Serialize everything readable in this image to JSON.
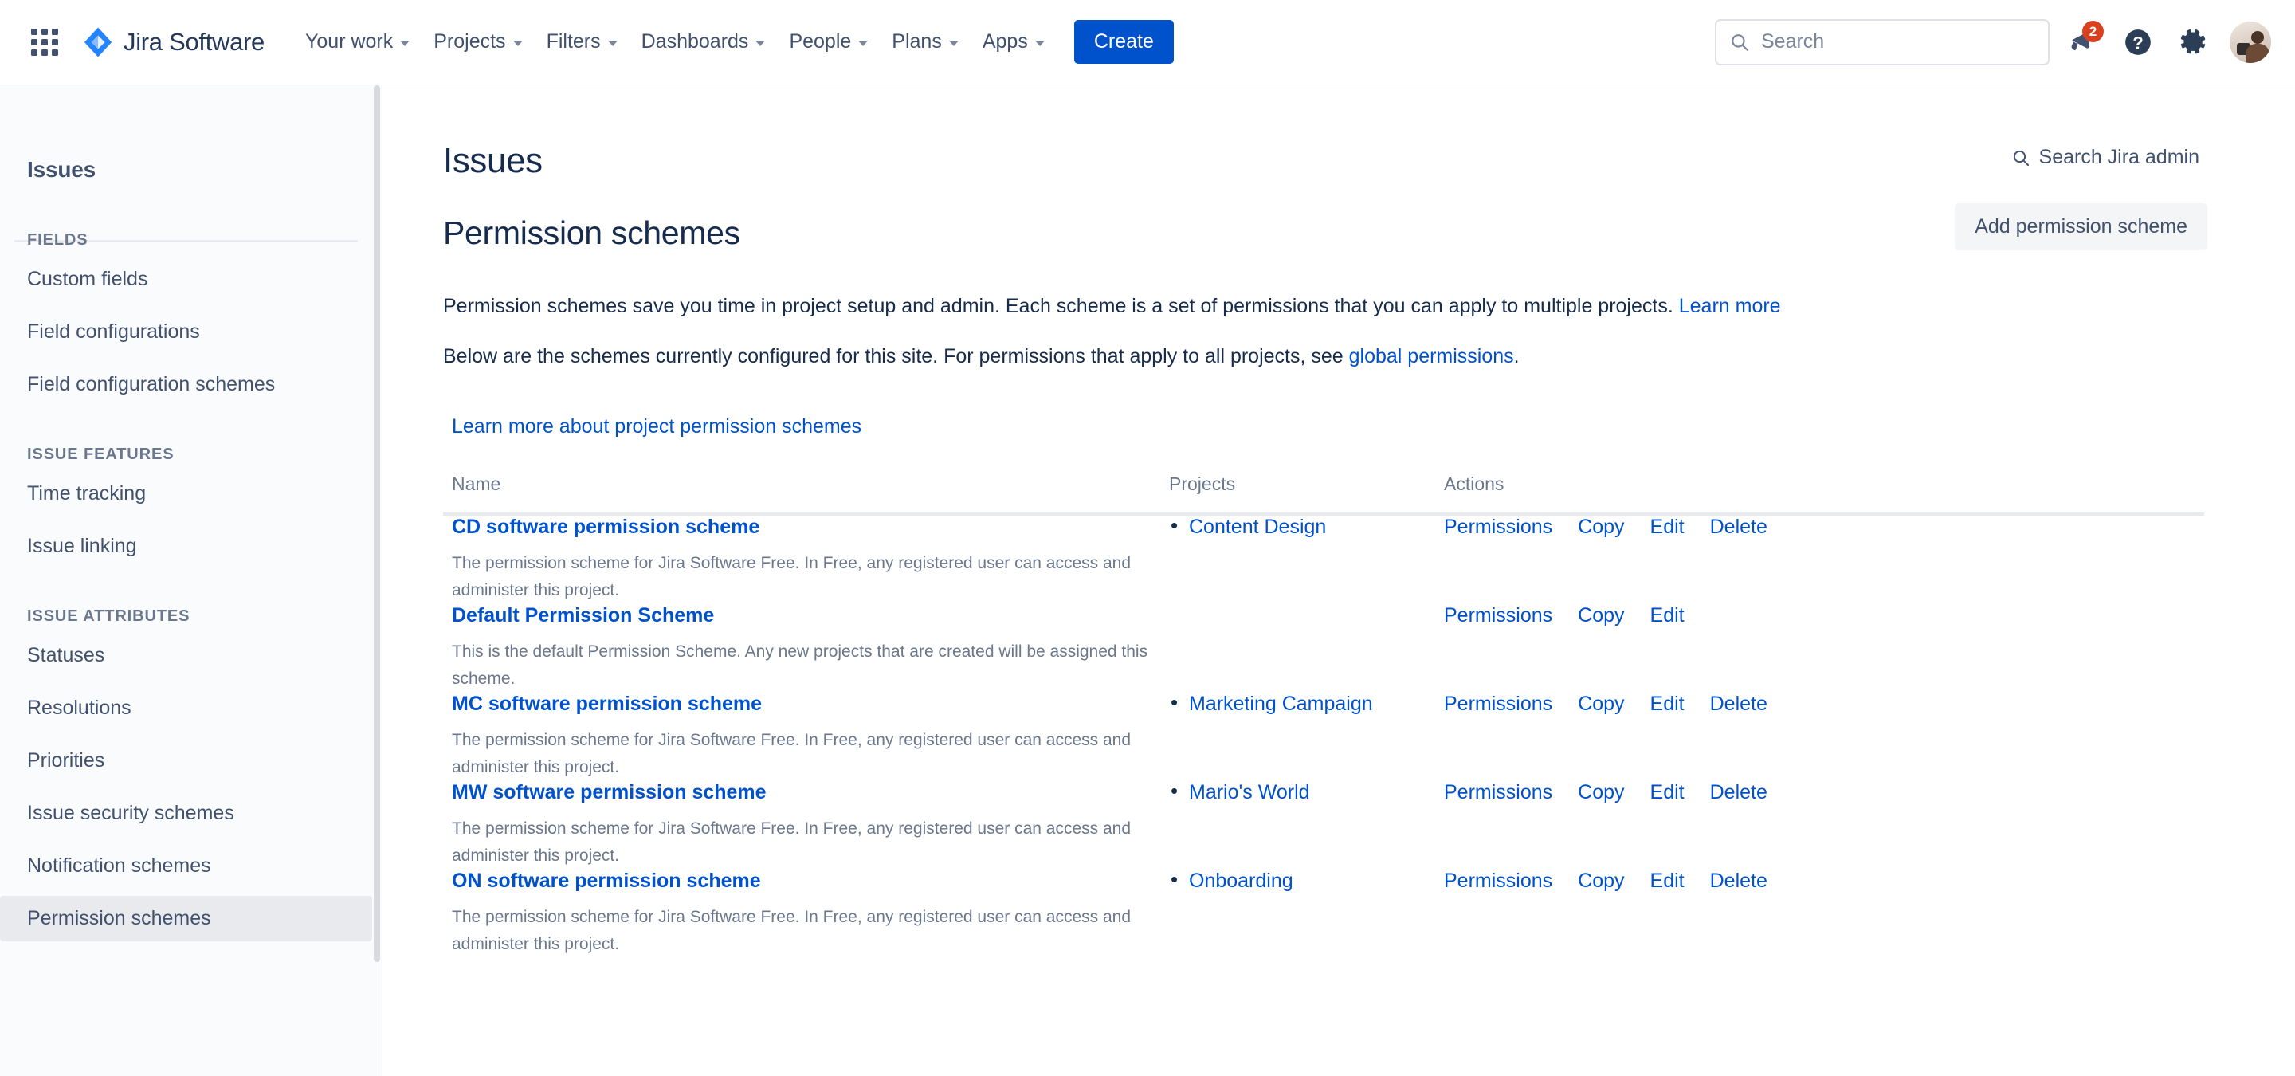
{
  "topnav": {
    "app_switcher_label": "App switcher",
    "brand": "Jira Software",
    "items": [
      {
        "label": "Your work"
      },
      {
        "label": "Projects"
      },
      {
        "label": "Filters"
      },
      {
        "label": "Dashboards"
      },
      {
        "label": "People"
      },
      {
        "label": "Plans"
      },
      {
        "label": "Apps"
      }
    ],
    "create_label": "Create",
    "search": {
      "value": "",
      "placeholder": "Search"
    },
    "notifications_badge": "2",
    "help_label": "Help",
    "settings_label": "Settings",
    "avatar_label": "Your profile and settings"
  },
  "sidebar": {
    "title": "Issues",
    "groups": [
      {
        "heading": "FIELDS",
        "items": [
          {
            "label": "Custom fields",
            "active": false
          },
          {
            "label": "Field configurations",
            "active": false
          },
          {
            "label": "Field configuration schemes",
            "active": false
          }
        ]
      },
      {
        "heading": "ISSUE FEATURES",
        "items": [
          {
            "label": "Time tracking",
            "active": false
          },
          {
            "label": "Issue linking",
            "active": false
          }
        ]
      },
      {
        "heading": "ISSUE ATTRIBUTES",
        "items": [
          {
            "label": "Statuses",
            "active": false
          },
          {
            "label": "Resolutions",
            "active": false
          },
          {
            "label": "Priorities",
            "active": false
          },
          {
            "label": "Issue security schemes",
            "active": false
          },
          {
            "label": "Notification schemes",
            "active": false
          },
          {
            "label": "Permission schemes",
            "active": true
          }
        ]
      }
    ]
  },
  "main": {
    "page_title": "Issues",
    "search_admin_label": "Search Jira admin",
    "section_title": "Permission schemes",
    "add_button_label": "Add permission scheme",
    "paragraph1_text": "Permission schemes save you time in project setup and admin. Each scheme is a set of permissions that you can apply to multiple projects. ",
    "paragraph1_link": "Learn more",
    "paragraph2_prefix": "Below are the schemes currently configured for this site. For permissions that apply to all projects, see ",
    "paragraph2_link": "global permissions",
    "paragraph2_suffix": ".",
    "learn_more_link": "Learn more about project permission schemes",
    "table": {
      "headers": {
        "name": "Name",
        "projects": "Projects",
        "actions": "Actions"
      },
      "rows": [
        {
          "name": "CD software permission scheme",
          "description": "The permission scheme for Jira Software Free. In Free, any registered user can access and administer this project.",
          "projects": [
            "Content Design"
          ],
          "actions": [
            "Permissions",
            "Copy",
            "Edit",
            "Delete"
          ]
        },
        {
          "name": "Default Permission Scheme",
          "description": "This is the default Permission Scheme. Any new projects that are created will be assigned this scheme.",
          "projects": [],
          "actions": [
            "Permissions",
            "Copy",
            "Edit"
          ]
        },
        {
          "name": "MC software permission scheme",
          "description": "The permission scheme for Jira Software Free. In Free, any registered user can access and administer this project.",
          "projects": [
            "Marketing Campaign"
          ],
          "actions": [
            "Permissions",
            "Copy",
            "Edit",
            "Delete"
          ]
        },
        {
          "name": "MW software permission scheme",
          "description": "The permission scheme for Jira Software Free. In Free, any registered user can access and administer this project.",
          "projects": [
            "Mario's World"
          ],
          "actions": [
            "Permissions",
            "Copy",
            "Edit",
            "Delete"
          ]
        },
        {
          "name": "ON software permission scheme",
          "description": "The permission scheme for Jira Software Free. In Free, any registered user can access and administer this project.",
          "projects": [
            "Onboarding"
          ],
          "actions": [
            "Permissions",
            "Copy",
            "Edit",
            "Delete"
          ]
        }
      ]
    }
  },
  "colors": {
    "brand_blue": "#0052cc",
    "link_blue": "#0052cc",
    "text_dark": "#172b4d",
    "text_muted": "#6b778c",
    "nav_text": "#42526e",
    "badge_red": "#d94020",
    "sidebar_bg": "#fafbfc",
    "active_bg": "#e9eaee"
  }
}
